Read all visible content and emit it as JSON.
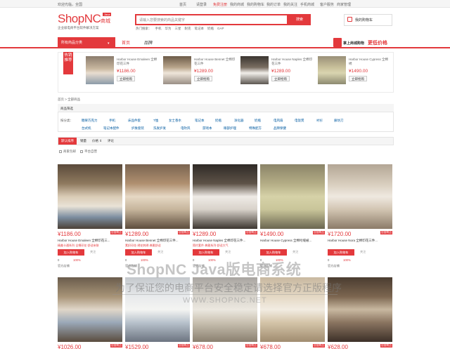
{
  "topbar": {
    "greeting": "欢迎光临，全国",
    "links": [
      "首页",
      "请登录",
      "免费注册",
      "我的商城",
      "我的购物车",
      "我的订单",
      "我的关注",
      "手机商城",
      "客户服务",
      "商家管理"
    ]
  },
  "header": {
    "logo": "ShopNC",
    "logo_badge": "Java",
    "logo_sub": "商城",
    "slogan": "企业级电商平台软件解决方案",
    "search_placeholder": "请输入您要搜索的商品关键字",
    "search_button": "搜索",
    "hot_words": [
      "热门搜索：",
      "手机",
      "华为",
      "三星",
      "耐克",
      "笔记本",
      "奶瓶",
      "GAP"
    ],
    "cart_label": "我的购物车"
  },
  "nav": {
    "category_button": "所有商品分类",
    "home": "首页",
    "brand": "品牌",
    "promo_text": "掌上商城购物",
    "promo_highlight": "更低价格"
  },
  "hot_sale": {
    "tag": "热销推荐",
    "items": [
      {
        "name": "Harbor House Emaleen 全棉印花三件",
        "price": "¥1186.00",
        "buy": "立即抢购"
      },
      {
        "name": "Harbor House Bennet 全棉印花三件",
        "price": "¥1289.00",
        "buy": "立即抢购"
      },
      {
        "name": "Harbor House Naples 全棉印花三件",
        "price": "¥1289.00",
        "buy": "立即抢购"
      },
      {
        "name": "Harbor House Cypress 全棉绣",
        "price": "¥1490.00",
        "buy": "立即抢购"
      }
    ]
  },
  "breadcrumb": "首页 > 全部商品",
  "filter": {
    "title": "商品筛选",
    "label": "按分类：",
    "options_row1": [
      "糖果巧克力",
      "手机",
      "床品件套",
      "T恤",
      "女士香水",
      "笔记本",
      "奶瓶",
      "净化器",
      "奶瓶",
      "电风扇",
      "电饭煲",
      "衬衫",
      "廊坊刀"
    ],
    "options_row2": [
      "台式机",
      "笔记本配件",
      "护肤套装",
      "洗发护发",
      "电吹风",
      "游戏本",
      "眼部护理",
      "特殊配方",
      "品牌保健"
    ]
  },
  "sort": {
    "default": "默认排序",
    "items": [
      "销量",
      "价格 ⇕",
      "评论"
    ],
    "checks": [
      "商家包邮",
      "平台自营"
    ]
  },
  "products": [
    {
      "price": "¥1186.00",
      "badge": "自营商品",
      "name": "Harbor House Emaleen 全棉印花三...",
      "desc": "精美卡通系列·全棉印花·舒适亲肤",
      "cart": "加入购物车",
      "follow": "关注",
      "count": "0",
      "rate": "100%",
      "store": "官方店铺"
    },
    {
      "price": "¥1289.00",
      "badge": "自营商品",
      "name": "Harbor House Bennet 全棉印花三件...",
      "desc": "素织印花·绣花刺绣·典雅舒适",
      "cart": "加入购物车",
      "follow": "关注",
      "count": "0",
      "rate": "100%",
      "store": "官方店铺"
    },
    {
      "price": "¥1289.00",
      "badge": "自营商品",
      "name": "Harbor House Naples 全棉印花三件...",
      "desc": "简约套件·典雅系列·舒适大气",
      "cart": "加入购物车",
      "follow": "关注",
      "count": "0",
      "rate": "100%",
      "store": "官方店铺"
    },
    {
      "price": "¥1490.00",
      "badge": "自营商品",
      "name": "Harbor House Cypress 全棉绗缝被...",
      "desc": "",
      "cart": "加入购物车",
      "follow": "关注",
      "count": "0",
      "rate": "100%",
      "store": "官方店铺"
    },
    {
      "price": "¥1720.00",
      "badge": "自营商品",
      "name": "Harbor House Nora 全棉印花三件...",
      "desc": "",
      "cart": "加入购物车",
      "follow": "关注",
      "count": "0",
      "rate": "100%",
      "store": "官方店铺"
    },
    {
      "price": "¥1026.00",
      "badge": "自营商品"
    },
    {
      "price": "¥1529.00",
      "badge": "自营商品"
    },
    {
      "price": "¥678.00",
      "badge": "自营商品"
    },
    {
      "price": "¥628.00",
      "badge": "自营商品"
    }
  ],
  "watermark": {
    "line1": "ShopNC Java版电商系统",
    "line2": "为了保证您的电商平台安全稳定请选择官方正版程序",
    "line3": "WWW.SHOPNC.NET"
  }
}
